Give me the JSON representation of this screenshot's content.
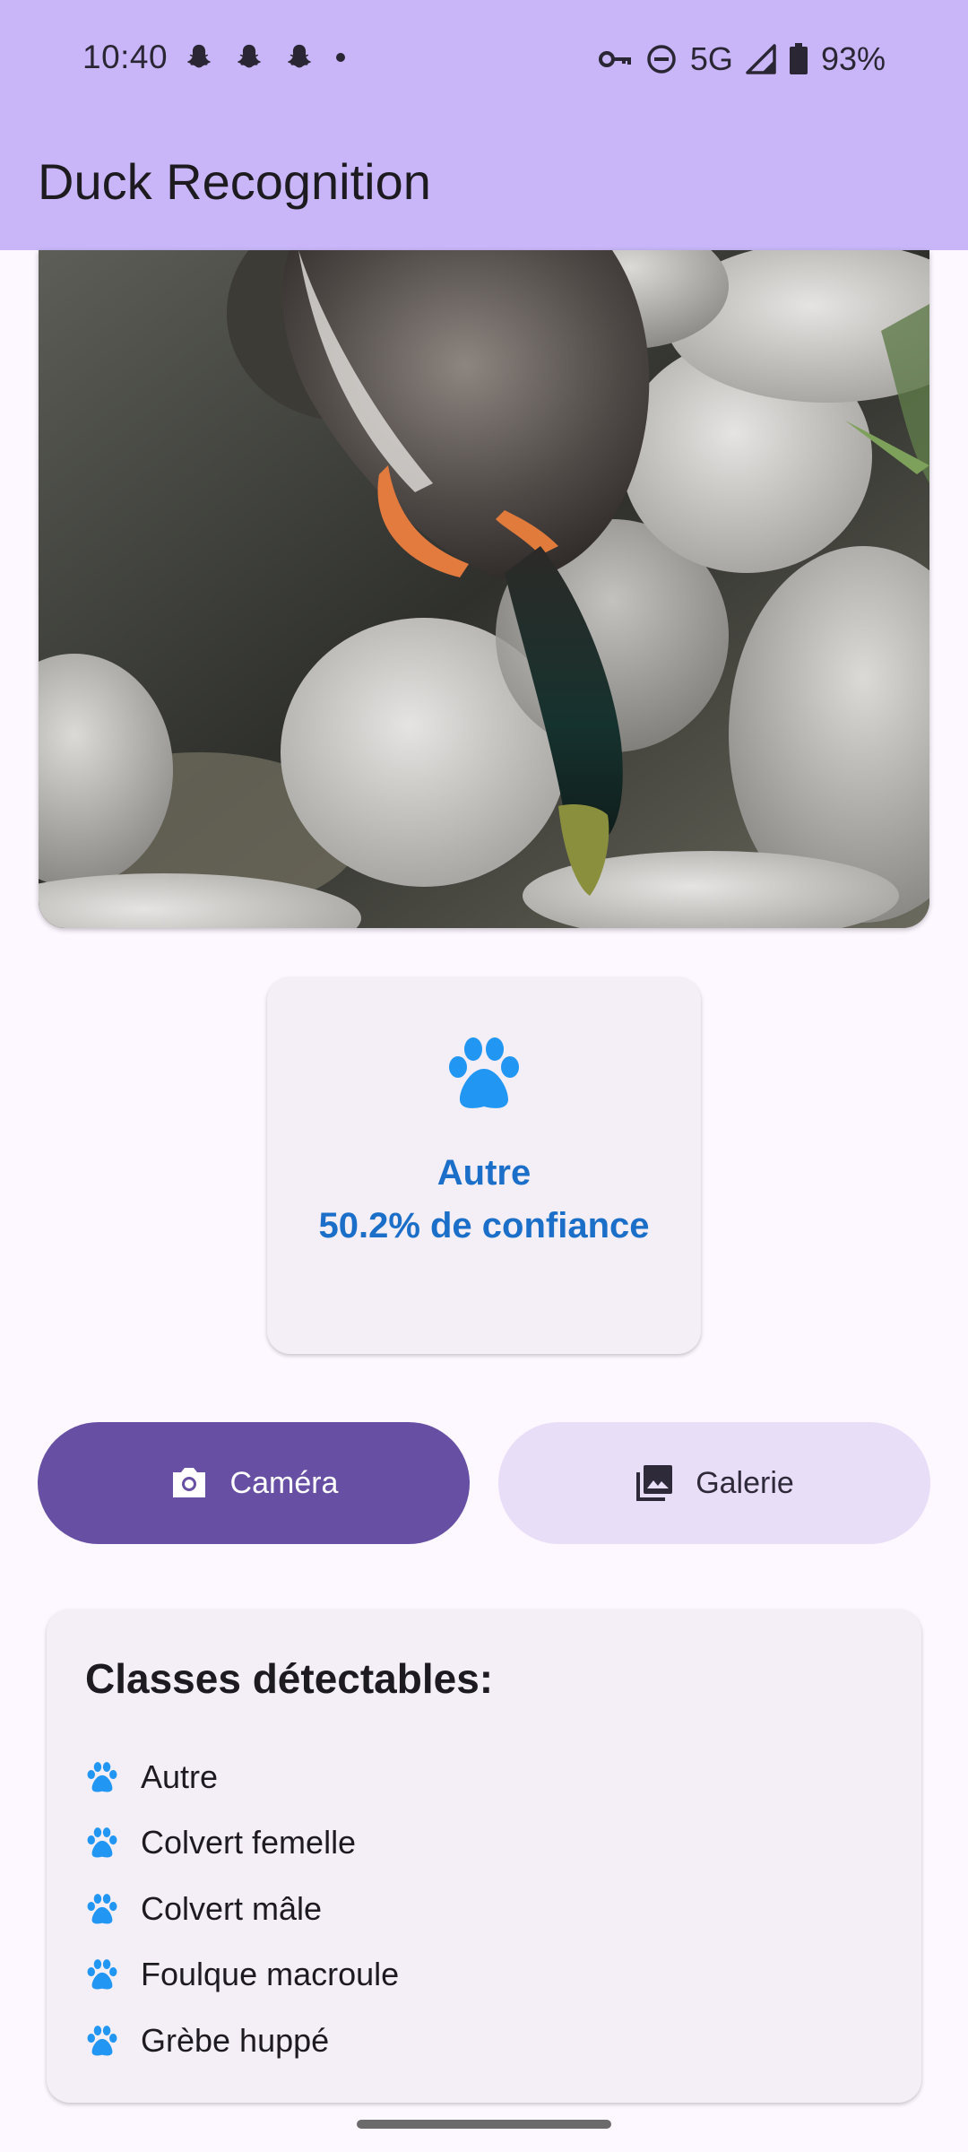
{
  "status_bar": {
    "time": "10:40",
    "network": "5G",
    "battery": "93%",
    "notification_icons": [
      "snapchat-icon",
      "snapchat-icon",
      "snapchat-icon",
      "dot-icon"
    ],
    "right_icons": [
      "vpn-key-icon",
      "do-not-disturb-icon",
      "signal-icon",
      "battery-icon"
    ]
  },
  "app_bar": {
    "title": "Duck Recognition",
    "color": "#c8b6f8"
  },
  "result": {
    "label": "Autre",
    "confidence_text": "50.2% de confiance",
    "icon": "paw-icon",
    "color": "#1b6fc8"
  },
  "buttons": {
    "camera": {
      "label": "Caméra",
      "icon": "camera-icon",
      "color": "#6750a4"
    },
    "gallery": {
      "label": "Galerie",
      "icon": "image-icon",
      "color": "#e8def8"
    }
  },
  "classes": {
    "title": "Classes détectables:",
    "items": [
      "Autre",
      "Colvert femelle",
      "Colvert mâle",
      "Foulque macroule",
      "Grèbe huppé"
    ]
  }
}
